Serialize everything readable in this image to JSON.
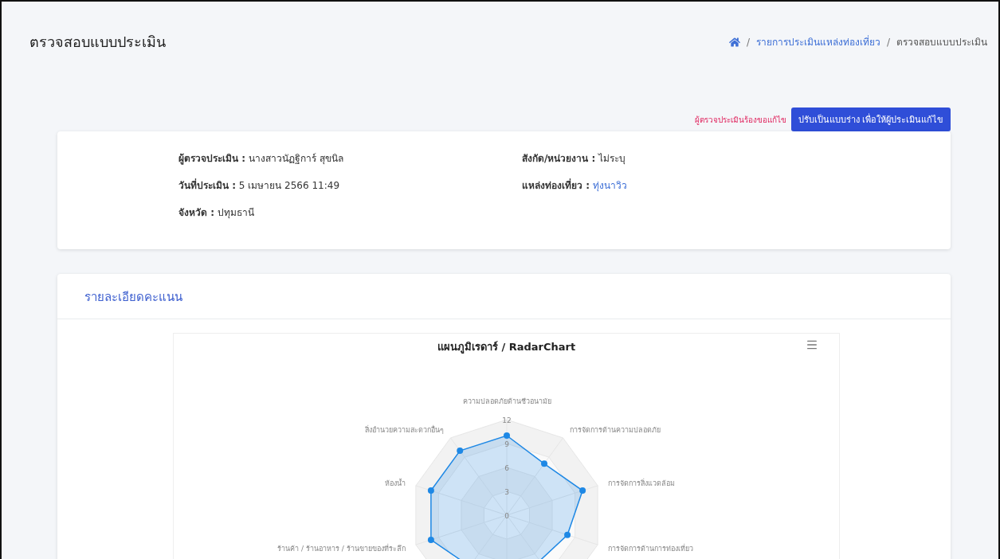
{
  "page": {
    "title": "ตรวจสอบแบบประเมิน"
  },
  "breadcrumb": [
    {
      "kind": "home"
    },
    {
      "kind": "link",
      "separator": "/",
      "label": "รายการประเมินแหล่งท่องเที่ยว"
    },
    {
      "kind": "current",
      "separator": "/",
      "label": "ตรวจสอบแบบประเมิน"
    }
  ],
  "actions": {
    "notice": "ผู้ตรวจประเมินร้องขอแก้ไข",
    "button": "ปรับเป็นแบบร่าง เพื่อให้ผู้ประเมินแก้ไข"
  },
  "info": [
    {
      "label": "ผู้ตรวจประเมิน :",
      "value": "นางสาวนัฏฐิการ์ สุขนิล",
      "kind": "text"
    },
    {
      "label": "สังกัด/หน่วยงาน :",
      "value": "ไม่ระบุ",
      "kind": "text"
    },
    {
      "label": "วันที่ประเมิน :",
      "value": "5 เมษายน 2566 11:49",
      "kind": "text"
    },
    {
      "label": "แหล่งท่องเที่ยว :",
      "value": "ทุ่งนาวิว",
      "kind": "link"
    },
    {
      "label": "จังหวัด :",
      "value": "ปทุมธานี",
      "kind": "text"
    }
  ],
  "score_card": {
    "title": "รายละเอียดคะแนน",
    "radar": {
      "title": "แผนภูมิเรดาร์ / RadarChart",
      "axis_labels": [
        "ความปลอดภัยด้านชีวอนามัย",
        "สิ่งอำนวยความสะดวกอื่นๆ",
        "การจัดการด้านความปลอดภัย",
        "ห้องน้ำ",
        "การจัดการสิ่งแวดล้อม",
        "ร้านค้า / ร้านอาหาร / ร้านขายของที่ระลึก",
        "การจัดการด้านการท่องเที่ยว"
      ],
      "tick_labels": [
        "12",
        "9",
        "6",
        "3",
        "0"
      ]
    }
  }
}
